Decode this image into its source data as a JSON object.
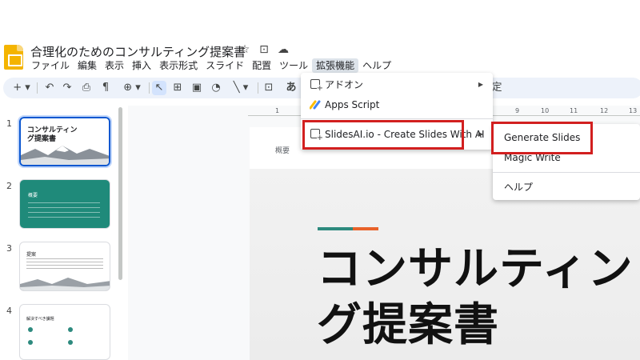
{
  "header": {
    "title": "合理化のためのコンサルティング提案書",
    "icons": [
      "star-icon",
      "move-to-folder-icon",
      "cloud-status-icon"
    ]
  },
  "menubar": [
    "ファイル",
    "編集",
    "表示",
    "挿入",
    "表示形式",
    "スライド",
    "配置",
    "ツール",
    "拡張機能",
    "ヘルプ"
  ],
  "menubar_active": "拡張機能",
  "toolbar": {
    "icons": [
      "new-slide-icon",
      "undo-icon",
      "redo-icon",
      "print-icon",
      "paint-format-icon",
      "zoom-icon",
      "select-icon",
      "text-box-icon",
      "image-icon",
      "shape-icon",
      "line-icon",
      "comment-icon"
    ],
    "font_glyph": "あ"
  },
  "ruler": {
    "ticks": [
      "1",
      "9",
      "10",
      "11",
      "12",
      "13"
    ]
  },
  "filmstrip": {
    "slides": [
      {
        "num": "1",
        "title": "コンサルティン\nグ提案書"
      },
      {
        "num": "2",
        "title": "概要"
      },
      {
        "num": "3",
        "title": "提案"
      },
      {
        "num": "4",
        "title": "解決すべき課題"
      }
    ]
  },
  "slide": {
    "nav_left": "概要",
    "title_line1": "コンサルティン",
    "title_line2": "グ提案書",
    "accent_colors": [
      "#2d8a7e",
      "#e8622a"
    ]
  },
  "extensions_menu": {
    "items": [
      {
        "label": "アドオン",
        "icon": "add-on-icon",
        "has_submenu": true
      },
      {
        "label": "Apps Script",
        "icon": "apps-script-icon",
        "has_submenu": false
      },
      {
        "label": "SlidesAI.io - Create Slides With AI",
        "icon": "add-on-icon",
        "has_submenu": true
      }
    ]
  },
  "slidesai_submenu": {
    "items": [
      "Generate Slides",
      "Magic Write",
      "ヘルプ"
    ]
  },
  "colors": {
    "highlight": "#d21f1f",
    "selection": "#0b57d0",
    "toolbar_bg": "#edf2fa"
  },
  "partial_label": "定"
}
